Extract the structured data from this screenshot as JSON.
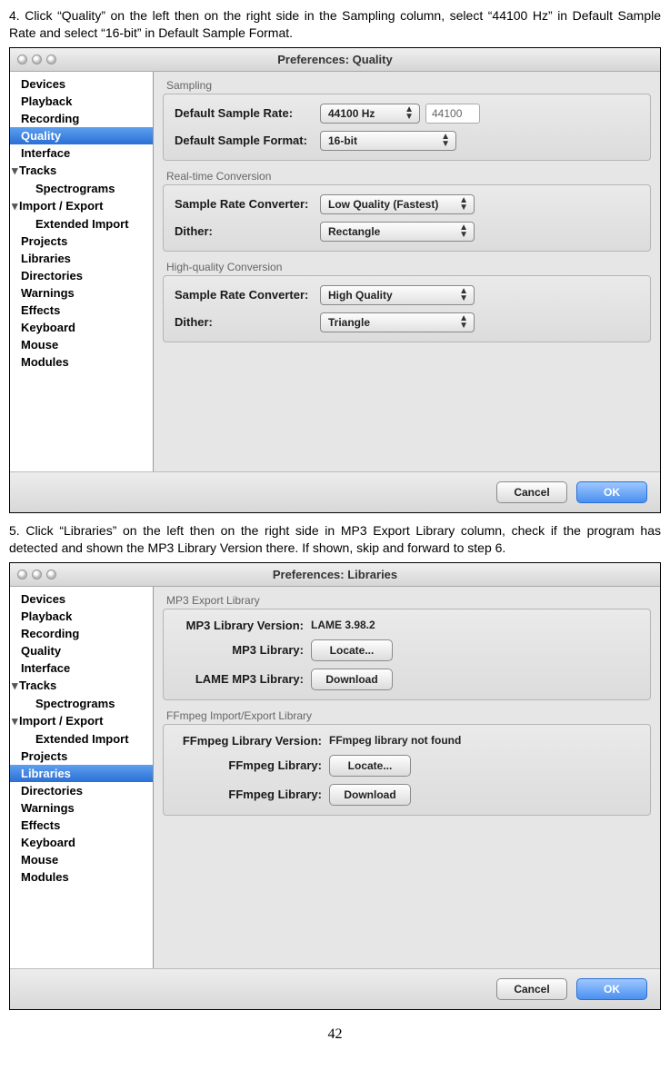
{
  "step4_text": "4.      Click “Quality” on the left then on the right side in the Sampling column, select “44100 Hz” in Default Sample Rate and select “16-bit” in Default Sample Format.",
  "step5_text": "5. Click “Libraries” on the left then on the right side in MP3 Export Library column, check if the program has detected and shown the MP3 Library Version there. If shown, skip and forward to step 6.",
  "page_number": "42",
  "win1": {
    "title": "Preferences: Quality",
    "sidebar": [
      {
        "label": "Devices",
        "indent": false,
        "arrow": false,
        "selected": false
      },
      {
        "label": "Playback",
        "indent": false,
        "arrow": false,
        "selected": false
      },
      {
        "label": "Recording",
        "indent": false,
        "arrow": false,
        "selected": false
      },
      {
        "label": "Quality",
        "indent": false,
        "arrow": false,
        "selected": true
      },
      {
        "label": "Interface",
        "indent": false,
        "arrow": false,
        "selected": false
      },
      {
        "label": "Tracks",
        "indent": false,
        "arrow": true,
        "selected": false
      },
      {
        "label": "Spectrograms",
        "indent": true,
        "arrow": false,
        "selected": false
      },
      {
        "label": "Import / Export",
        "indent": false,
        "arrow": true,
        "selected": false
      },
      {
        "label": "Extended Import",
        "indent": true,
        "arrow": false,
        "selected": false
      },
      {
        "label": "Projects",
        "indent": false,
        "arrow": false,
        "selected": false
      },
      {
        "label": "Libraries",
        "indent": false,
        "arrow": false,
        "selected": false
      },
      {
        "label": "Directories",
        "indent": false,
        "arrow": false,
        "selected": false
      },
      {
        "label": "Warnings",
        "indent": false,
        "arrow": false,
        "selected": false
      },
      {
        "label": "Effects",
        "indent": false,
        "arrow": false,
        "selected": false
      },
      {
        "label": "Keyboard",
        "indent": false,
        "arrow": false,
        "selected": false
      },
      {
        "label": "Mouse",
        "indent": false,
        "arrow": false,
        "selected": false
      },
      {
        "label": "Modules",
        "indent": false,
        "arrow": false,
        "selected": false
      }
    ],
    "groups": {
      "sampling_label": "Sampling",
      "default_rate_label": "Default Sample Rate:",
      "default_rate_value": "44100 Hz",
      "default_rate_text": "44100",
      "default_format_label": "Default Sample Format:",
      "default_format_value": "16-bit",
      "realtime_label": "Real-time Conversion",
      "rt_converter_label": "Sample Rate Converter:",
      "rt_converter_value": "Low Quality (Fastest)",
      "rt_dither_label": "Dither:",
      "rt_dither_value": "Rectangle",
      "hq_label": "High-quality Conversion",
      "hq_converter_label": "Sample Rate Converter:",
      "hq_converter_value": "High Quality",
      "hq_dither_label": "Dither:",
      "hq_dither_value": "Triangle"
    },
    "buttons": {
      "cancel": "Cancel",
      "ok": "OK"
    }
  },
  "win2": {
    "title": "Preferences: Libraries",
    "sidebar": [
      {
        "label": "Devices",
        "indent": false,
        "arrow": false,
        "selected": false
      },
      {
        "label": "Playback",
        "indent": false,
        "arrow": false,
        "selected": false
      },
      {
        "label": "Recording",
        "indent": false,
        "arrow": false,
        "selected": false
      },
      {
        "label": "Quality",
        "indent": false,
        "arrow": false,
        "selected": false
      },
      {
        "label": "Interface",
        "indent": false,
        "arrow": false,
        "selected": false
      },
      {
        "label": "Tracks",
        "indent": false,
        "arrow": true,
        "selected": false
      },
      {
        "label": "Spectrograms",
        "indent": true,
        "arrow": false,
        "selected": false
      },
      {
        "label": "Import / Export",
        "indent": false,
        "arrow": true,
        "selected": false
      },
      {
        "label": "Extended Import",
        "indent": true,
        "arrow": false,
        "selected": false
      },
      {
        "label": "Projects",
        "indent": false,
        "arrow": false,
        "selected": false
      },
      {
        "label": "Libraries",
        "indent": false,
        "arrow": false,
        "selected": true
      },
      {
        "label": "Directories",
        "indent": false,
        "arrow": false,
        "selected": false
      },
      {
        "label": "Warnings",
        "indent": false,
        "arrow": false,
        "selected": false
      },
      {
        "label": "Effects",
        "indent": false,
        "arrow": false,
        "selected": false
      },
      {
        "label": "Keyboard",
        "indent": false,
        "arrow": false,
        "selected": false
      },
      {
        "label": "Mouse",
        "indent": false,
        "arrow": false,
        "selected": false
      },
      {
        "label": "Modules",
        "indent": false,
        "arrow": false,
        "selected": false
      }
    ],
    "groups": {
      "mp3_label": "MP3 Export Library",
      "mp3_version_label": "MP3 Library Version:",
      "mp3_version_value": "LAME 3.98.2",
      "mp3_library_label": "MP3 Library:",
      "mp3_library_btn": "Locate...",
      "lame_label": "LAME MP3 Library:",
      "lame_btn": "Download",
      "ffmpeg_label": "FFmpeg Import/Export Library",
      "ff_version_label": "FFmpeg Library Version:",
      "ff_version_value": "FFmpeg library not found",
      "ff_library_label": "FFmpeg Library:",
      "ff_library_btn": "Locate...",
      "ff_download_label": "FFmpeg Library:",
      "ff_download_btn": "Download"
    },
    "buttons": {
      "cancel": "Cancel",
      "ok": "OK"
    }
  }
}
